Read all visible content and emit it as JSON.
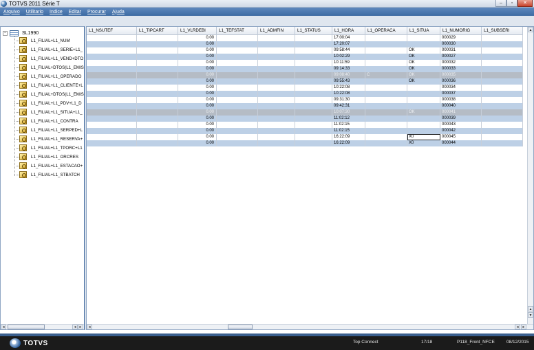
{
  "window": {
    "title": "TOTVS 2011 Série T",
    "buttons": [
      "–",
      "▫",
      "✕"
    ]
  },
  "menu": [
    "Arquivo",
    "Utilitario",
    "Indice",
    "Editar",
    "Procurar",
    "Ajuda"
  ],
  "tree": {
    "root_label": "SL1990",
    "expander": "−",
    "items": [
      "L1_FILIAL+L1_NUM",
      "L1_FILIAL+L1_SERIE+L1_",
      "L1_FILIAL+L1_VEND+DTO",
      "L1_FILIAL+DTOS(L1_EMIS",
      "L1_FILIAL+L1_OPERADO",
      "L1_FILIAL+L1_CLIENTE+L",
      "L1_FILIAL+DTOS(L1_EMIS",
      "L1_FILIAL+L1_PDV+L1_D",
      "L1_FILIAL+L1_SITUA+L1_",
      "L1_FILIAL+L1_CONTRA",
      "L1_FILIAL+L1_SERPED+L",
      "L1_FILIAL+L1_RESERVA+",
      "L1_FILIAL+L1_TPORC+L1",
      "L1_FILIAL+L1_ORCRES",
      "L1_FILIAL+L1_ESTACAO+",
      "L1_FILIAL+L1_STBATCH"
    ]
  },
  "grid": {
    "columns": [
      "L1_NSUTEF",
      "L1_TIPCART",
      "L1_VLRDEBI",
      "L1_TEFSTAT",
      "L1_ADMFIN",
      "L1_STATUS",
      "L1_HORA",
      "L1_OPERACA",
      "L1_SITUA",
      "L1_NUMORIG",
      "L1_SUBSERI"
    ],
    "rows": [
      {
        "style": "white",
        "cells": [
          "",
          "",
          "0.00",
          "",
          "",
          "",
          "17:00:04",
          "",
          "",
          "000029",
          ""
        ]
      },
      {
        "style": "blue",
        "cells": [
          "",
          "",
          "0.00",
          "",
          "",
          "",
          "17:20:07",
          "",
          "",
          "000030",
          ""
        ]
      },
      {
        "style": "white",
        "cells": [
          "",
          "",
          "0.00",
          "",
          "",
          "",
          "09:58:44",
          "",
          "OK",
          "000031",
          ""
        ]
      },
      {
        "style": "blue",
        "cells": [
          "",
          "",
          "0.00",
          "",
          "",
          "",
          "10:02:29",
          "",
          "OK",
          "000027",
          ""
        ]
      },
      {
        "style": "white",
        "cells": [
          "",
          "",
          "0.00",
          "",
          "",
          "",
          "10:11:59",
          "",
          "OK",
          "000032",
          ""
        ]
      },
      {
        "style": "blue",
        "cells": [
          "",
          "",
          "0.00",
          "",
          "",
          "",
          "09:14:33",
          "",
          "OK",
          "000033",
          ""
        ]
      },
      {
        "style": "sel",
        "cells": [
          "",
          "",
          "0.00",
          "",
          "",
          "",
          "09:08:40",
          "C",
          "OK",
          "000035",
          ""
        ]
      },
      {
        "style": "blue",
        "cells": [
          "",
          "",
          "0.00",
          "",
          "",
          "",
          "09:55:43",
          "",
          "OK",
          "000036",
          ""
        ]
      },
      {
        "style": "white",
        "cells": [
          "",
          "",
          "0.00",
          "",
          "",
          "",
          "10:22:08",
          "",
          "",
          "000034",
          ""
        ]
      },
      {
        "style": "blue",
        "cells": [
          "",
          "",
          "0.00",
          "",
          "",
          "",
          "10:22:08",
          "",
          "",
          "000037",
          ""
        ]
      },
      {
        "style": "white",
        "cells": [
          "",
          "",
          "0.00",
          "",
          "",
          "",
          "09:31:30",
          "",
          "",
          "000038",
          ""
        ]
      },
      {
        "style": "blue",
        "cells": [
          "",
          "",
          "0.00",
          "",
          "",
          "",
          "09:42:31",
          "",
          "",
          "000040",
          ""
        ]
      },
      {
        "style": "sel",
        "cells": [
          "",
          "",
          "0.00",
          "",
          "",
          "",
          "10:07:30",
          "",
          "OK",
          "000041",
          ""
        ]
      },
      {
        "style": "blue",
        "cells": [
          "",
          "",
          "0.00",
          "",
          "",
          "",
          "11:02:12",
          "",
          "",
          "000039",
          ""
        ]
      },
      {
        "style": "white",
        "cells": [
          "",
          "",
          "0.00",
          "",
          "",
          "",
          "11:02:15",
          "",
          "",
          "000043",
          ""
        ]
      },
      {
        "style": "blue",
        "cells": [
          "",
          "",
          "0.00",
          "",
          "",
          "",
          "11:02:15",
          "",
          "",
          "000042",
          ""
        ]
      },
      {
        "style": "white",
        "cells": [
          "",
          "",
          "0.00",
          "",
          "",
          "",
          "16:22:09",
          "",
          "X0",
          "000045",
          ""
        ]
      },
      {
        "style": "blue",
        "cells": [
          "",
          "",
          "0.00",
          "",
          "",
          "",
          "16:22:09",
          "",
          "X0",
          "000044",
          ""
        ]
      }
    ]
  },
  "scroll_arrows": {
    "left": "◂",
    "right": "▸",
    "up": "▴",
    "down": "▾"
  },
  "statusbar": {
    "logo_text": "TOTVS",
    "connection": "Top Connect",
    "record": "17/18",
    "environment": "P118_Front_NFCE",
    "date": "08/12/2015"
  },
  "colors": {
    "menu": "#3d6ba3",
    "row_blue": "#bdd0e6",
    "row_selected": "#b5bcc5",
    "status_bar": "#1b1b1b"
  }
}
